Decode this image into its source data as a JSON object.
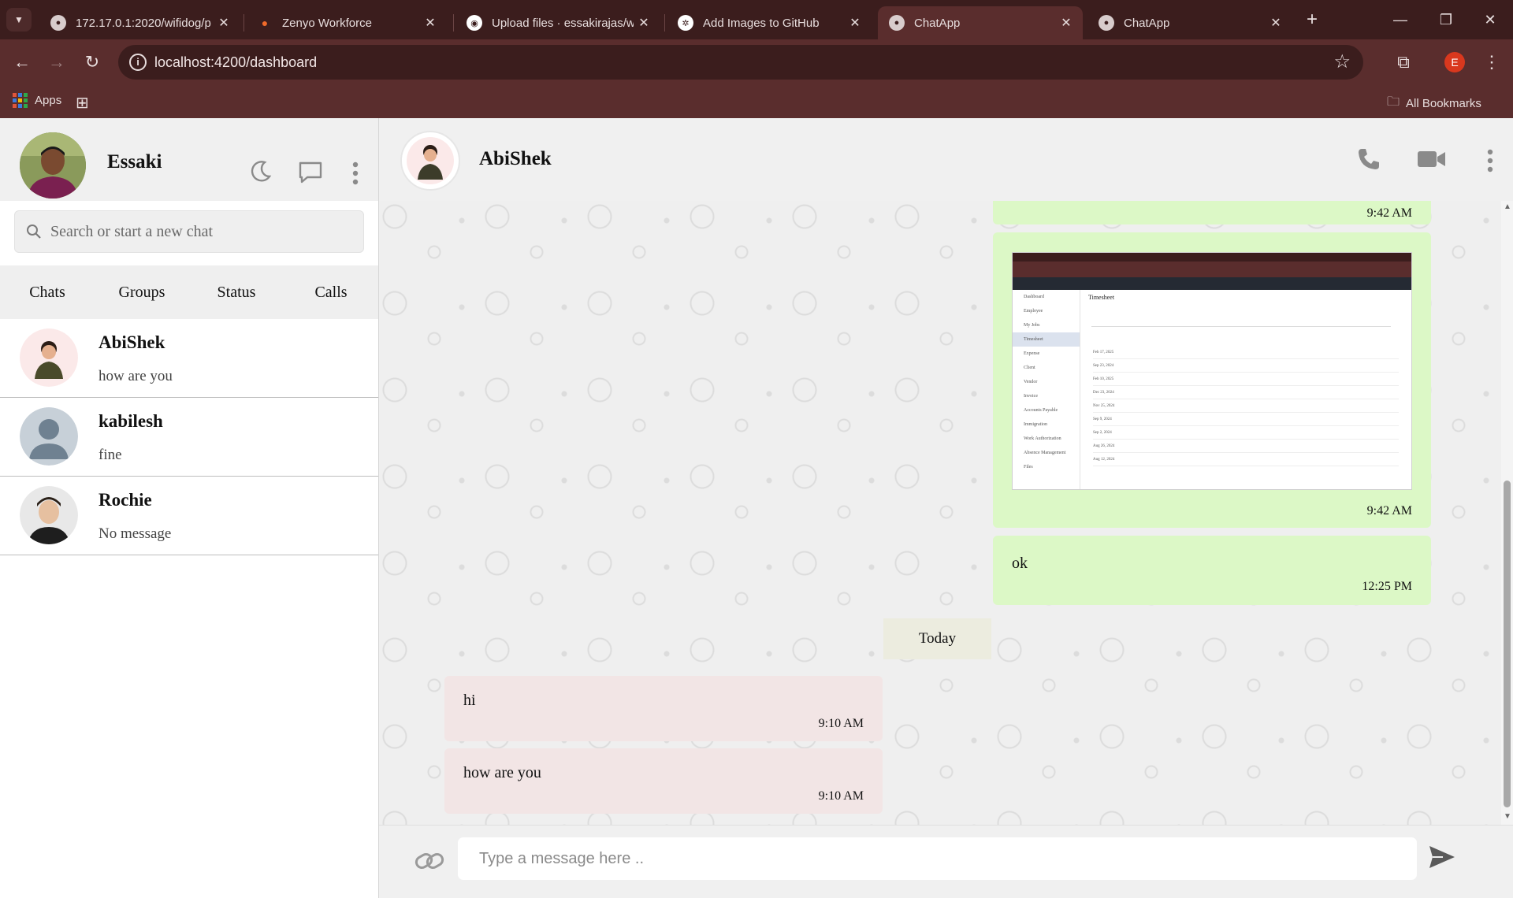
{
  "browser": {
    "tabs": [
      {
        "title": "172.17.0.1:2020/wifidog/p",
        "active": false
      },
      {
        "title": "Zenyo Workforce",
        "active": false
      },
      {
        "title": "Upload files · essakirajas/w",
        "active": false
      },
      {
        "title": "Add Images to GitHub",
        "active": false
      },
      {
        "title": "ChatApp",
        "active": true
      },
      {
        "title": "ChatApp",
        "active": false
      }
    ],
    "url": "localhost:4200/dashboard",
    "profile_initial": "E",
    "bookmarks": {
      "apps_label": "Apps",
      "all_bookmarks_label": "All Bookmarks"
    }
  },
  "sidebar": {
    "user_name": "Essaki",
    "search_placeholder": "Search or start a new chat",
    "tabs": [
      "Chats",
      "Groups",
      "Status",
      "Calls"
    ],
    "chats": [
      {
        "name": "AbiShek",
        "last_message": "how are you"
      },
      {
        "name": "kabilesh",
        "last_message": "fine"
      },
      {
        "name": "Rochie",
        "last_message": "No message"
      }
    ]
  },
  "chat": {
    "contact_name": "AbiShek",
    "messages": [
      {
        "direction": "out",
        "time": "9:42 AM"
      },
      {
        "direction": "out",
        "type": "image",
        "time": "9:42 AM",
        "image": {
          "title": "Timesheet",
          "nav": [
            "Dashboard",
            "Employee",
            "My Jobs",
            "Timesheet",
            "Expense",
            "Client",
            "Vendor",
            "Invoice",
            "Accounts Payable",
            "Immigration",
            "Work Authorization",
            "Absence Management",
            "Files"
          ],
          "rows": [
            "Feb 17, 2025",
            "Sep 23, 2024",
            "Feb 10, 2025",
            "Dec 23, 2024",
            "Nov 25, 2024",
            "Sep 9, 2024",
            "Sep 2, 2024",
            "Aug 26, 2024",
            "Aug 12, 2024"
          ]
        }
      },
      {
        "direction": "out",
        "text": "ok",
        "time": "12:25 PM"
      },
      {
        "direction": "in",
        "text": "hi",
        "time": "9:10 AM"
      },
      {
        "direction": "in",
        "text": "how are you",
        "time": "9:10 AM"
      }
    ],
    "date_divider": "Today",
    "composer_placeholder": "Type a message here .."
  },
  "icons": [
    "search-icon",
    "moon-icon",
    "new-chat-icon",
    "menu-dots-icon",
    "phone-icon",
    "video-icon",
    "attach-link-icon",
    "send-icon",
    "star-icon",
    "info-icon",
    "extensions-icon"
  ],
  "colors": {
    "outgoing_bubble": "#dcf8c6",
    "incoming_bubble": "#f2e5e5",
    "browser_frame": "#5a2d2d",
    "tabstrip": "#3b1d1d"
  }
}
